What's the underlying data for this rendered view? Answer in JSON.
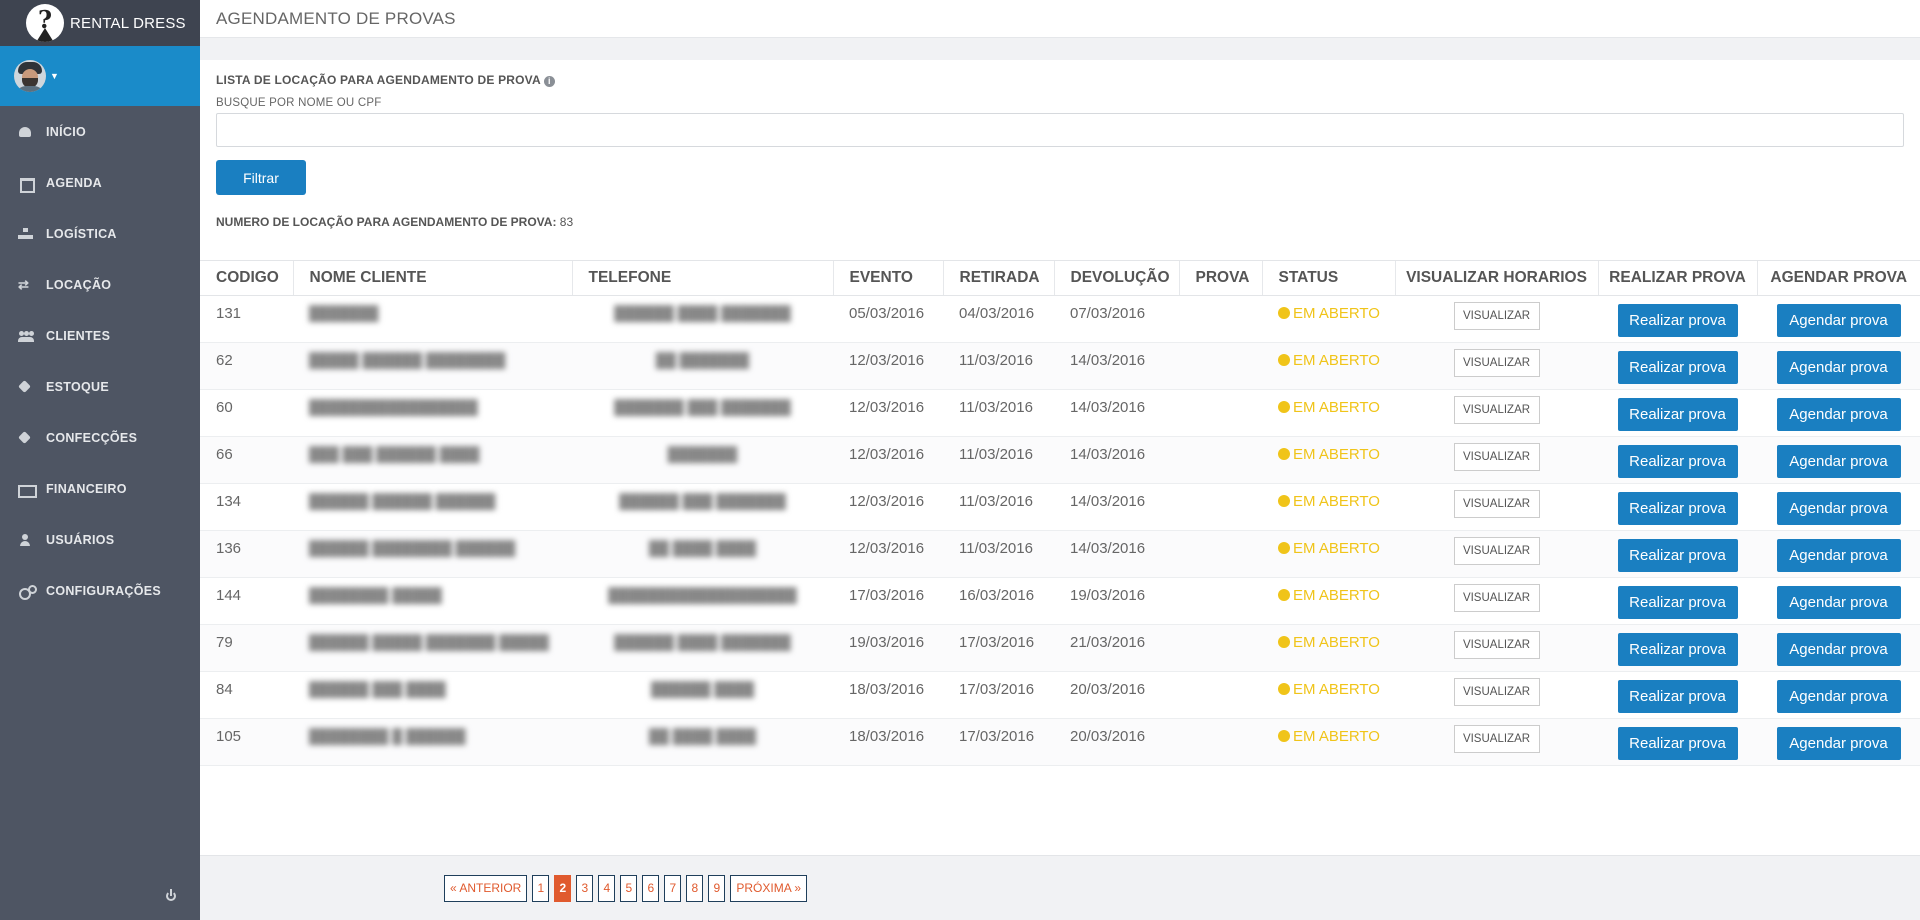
{
  "app": {
    "name": "RENTAL DRESS"
  },
  "sidebar": {
    "items": [
      {
        "label": "INÍCIO",
        "icon": "dashboard-icon"
      },
      {
        "label": "AGENDA",
        "icon": "calendar-icon"
      },
      {
        "label": "LOGÍSTICA",
        "icon": "sitemap-icon"
      },
      {
        "label": "LOCAÇÃO",
        "icon": "exchange-icon"
      },
      {
        "label": "CLIENTES",
        "icon": "users-icon"
      },
      {
        "label": "ESTOQUE",
        "icon": "tag-icon"
      },
      {
        "label": "CONFECÇÕES",
        "icon": "tag-icon"
      },
      {
        "label": "FINANCEIRO",
        "icon": "money-icon"
      },
      {
        "label": "USUÁRIOS",
        "icon": "user-icon"
      },
      {
        "label": "CONFIGURAÇÕES",
        "icon": "cogs-icon"
      }
    ]
  },
  "header": {
    "title": "AGENDAMENTO DE PROVAS"
  },
  "main": {
    "section_title": "LISTA DE LOCAÇÃO PARA AGENDAMENTO DE PROVA",
    "search_label": "BUSQUE POR NOME OU CPF",
    "search_value": "",
    "filter_label": "Filtrar",
    "count_label": "NUMERO DE LOCAÇÃO PARA AGENDAMENTO DE PROVA:",
    "count_value": "83"
  },
  "table": {
    "headers": [
      "CODIGO",
      "NOME CLIENTE",
      "TELEFONE",
      "EVENTO",
      "RETIRADA",
      "DEVOLUÇÃO",
      "PROVA",
      "STATUS",
      "VISUALIZAR HORARIOS",
      "REALIZAR PROVA",
      "AGENDAR PROVA"
    ],
    "view_label": "VISUALIZAR",
    "realizar_label": "Realizar prova",
    "agendar_label": "Agendar prova",
    "status_color": "#f0c419",
    "rows": [
      {
        "codigo": "131",
        "nome": "",
        "telefone": "",
        "evento": "05/03/2016",
        "retirada": "04/03/2016",
        "devolucao": "07/03/2016",
        "prova": "",
        "status": "EM ABERTO"
      },
      {
        "codigo": "62",
        "nome": "",
        "telefone": "",
        "evento": "12/03/2016",
        "retirada": "11/03/2016",
        "devolucao": "14/03/2016",
        "prova": "",
        "status": "EM ABERTO"
      },
      {
        "codigo": "60",
        "nome": "",
        "telefone": "",
        "evento": "12/03/2016",
        "retirada": "11/03/2016",
        "devolucao": "14/03/2016",
        "prova": "",
        "status": "EM ABERTO"
      },
      {
        "codigo": "66",
        "nome": "",
        "telefone": "",
        "evento": "12/03/2016",
        "retirada": "11/03/2016",
        "devolucao": "14/03/2016",
        "prova": "",
        "status": "EM ABERTO"
      },
      {
        "codigo": "134",
        "nome": "",
        "telefone": "",
        "evento": "12/03/2016",
        "retirada": "11/03/2016",
        "devolucao": "14/03/2016",
        "prova": "",
        "status": "EM ABERTO"
      },
      {
        "codigo": "136",
        "nome": "",
        "telefone": "",
        "evento": "12/03/2016",
        "retirada": "11/03/2016",
        "devolucao": "14/03/2016",
        "prova": "",
        "status": "EM ABERTO"
      },
      {
        "codigo": "144",
        "nome": "",
        "telefone": "",
        "evento": "17/03/2016",
        "retirada": "16/03/2016",
        "devolucao": "19/03/2016",
        "prova": "",
        "status": "EM ABERTO"
      },
      {
        "codigo": "79",
        "nome": "",
        "telefone": "",
        "evento": "19/03/2016",
        "retirada": "17/03/2016",
        "devolucao": "21/03/2016",
        "prova": "",
        "status": "EM ABERTO"
      },
      {
        "codigo": "84",
        "nome": "",
        "telefone": "",
        "evento": "18/03/2016",
        "retirada": "17/03/2016",
        "devolucao": "20/03/2016",
        "prova": "",
        "status": "EM ABERTO"
      },
      {
        "codigo": "105",
        "nome": "",
        "telefone": "",
        "evento": "18/03/2016",
        "retirada": "17/03/2016",
        "devolucao": "20/03/2016",
        "prova": "",
        "status": "EM ABERTO"
      }
    ]
  },
  "pagination": {
    "prev": "« ANTERIOR",
    "next": "PRÓXIMA »",
    "pages": [
      "1",
      "2",
      "3",
      "4",
      "5",
      "6",
      "7",
      "8",
      "9"
    ],
    "active": "2"
  }
}
